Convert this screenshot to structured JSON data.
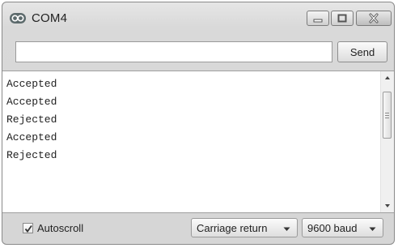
{
  "window": {
    "title": "COM4",
    "icon": "serial-monitor-icon",
    "controls": [
      "minimize-icon",
      "maximize-icon",
      "close-icon"
    ]
  },
  "send_bar": {
    "input_value": "",
    "send_label": "Send"
  },
  "output": {
    "lines": [
      "Accepted",
      "Accepted",
      "Rejected",
      "Accepted",
      "Rejected"
    ]
  },
  "footer": {
    "autoscroll_label": "Autoscroll",
    "autoscroll_checked": true,
    "line_ending": "Carriage return",
    "baud_rate": "9600 baud"
  }
}
